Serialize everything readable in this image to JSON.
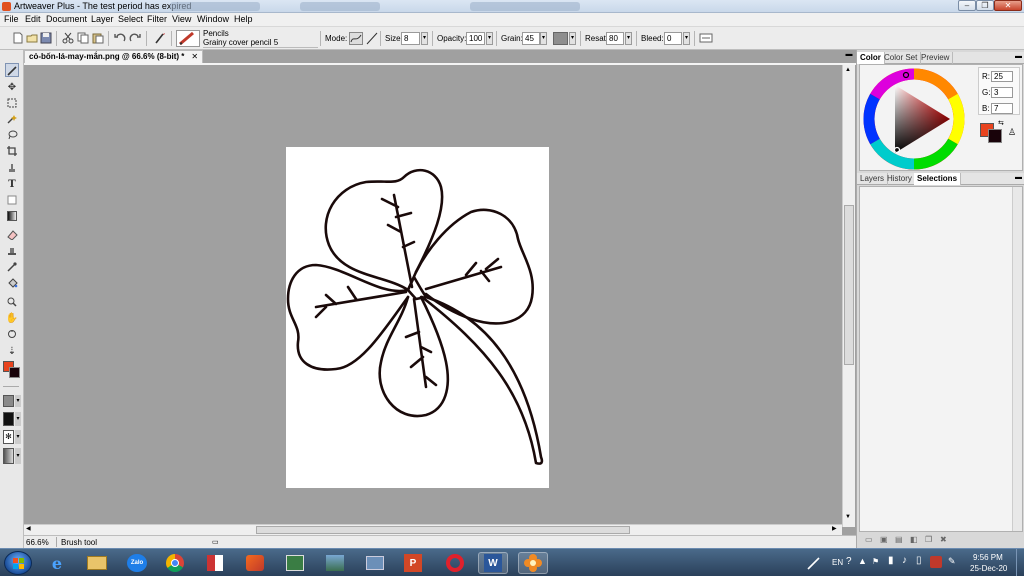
{
  "window": {
    "title": "Artweaver Plus - The test period has expired"
  },
  "menu": [
    "File",
    "Edit",
    "Document",
    "Layer",
    "Select",
    "Filter",
    "View",
    "Window",
    "Help"
  ],
  "options_bar": {
    "brush_category": "Pencils",
    "brush_variant": "Grainy cover pencil 5",
    "mode_label": "Mode:",
    "size_label": "Size:",
    "size_value": "8",
    "opacity_label": "Opacity:",
    "opacity_value": "100",
    "grain_label": "Grain:",
    "grain_value": "45",
    "resat_label": "Resat:",
    "resat_value": "80",
    "bleed_label": "Bleed:",
    "bleed_value": "0"
  },
  "document": {
    "tab_title": "cỏ-bốn-lá-may-mắn.png @ 66.6% (8-bit) *",
    "close_glyph": "✕"
  },
  "status": {
    "zoom": "66.6%",
    "tool": "Brush tool"
  },
  "color_panel": {
    "tabs": [
      "Color",
      "Color Set",
      "Preview"
    ],
    "r_label": "R:",
    "r_value": "25",
    "g_label": "G:",
    "g_value": "3",
    "b_label": "B:",
    "b_value": "7",
    "foreground": "#e8431e",
    "background": "#19030a"
  },
  "layers_panel": {
    "tabs": [
      "Layers",
      "History",
      "Selections"
    ]
  },
  "taskbar": {
    "apps": [
      "internet-explorer",
      "file-explorer",
      "zalo",
      "chrome",
      "app",
      "paint",
      "app",
      "app",
      "app",
      "powerpoint",
      "opera",
      "word",
      "artweaver"
    ],
    "zalo_label": "Zalo",
    "lang": "EN",
    "time": "9:56 PM",
    "date": "25-Dec-20"
  }
}
